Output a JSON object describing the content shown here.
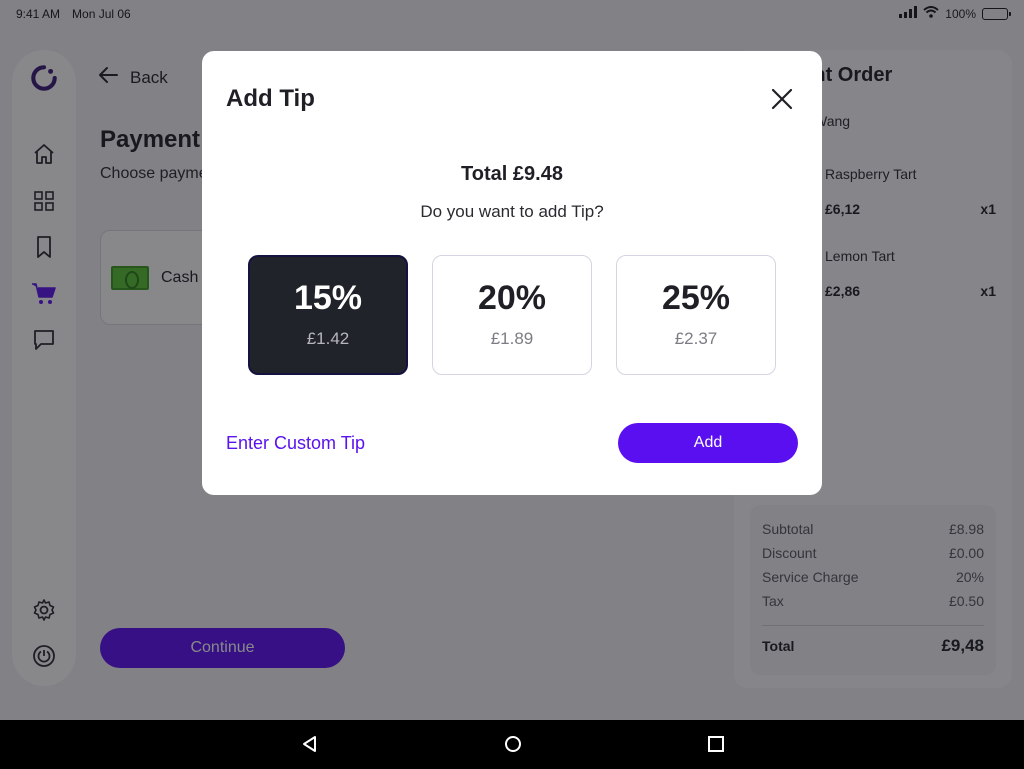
{
  "status_bar": {
    "time": "9:41 AM",
    "date": "Mon Jul 06",
    "battery": "100%"
  },
  "sidebar": {
    "items": [
      {
        "name": "home",
        "icon": "home-icon"
      },
      {
        "name": "grid",
        "icon": "grid-icon"
      },
      {
        "name": "bookmark",
        "icon": "bookmark-icon"
      },
      {
        "name": "cart",
        "icon": "cart-icon",
        "active": true
      },
      {
        "name": "chat",
        "icon": "chat-icon"
      },
      {
        "name": "settings",
        "icon": "gear-icon"
      },
      {
        "name": "power",
        "icon": "power-icon"
      }
    ],
    "active_color": "#5a12ee"
  },
  "page": {
    "back_label": "Back",
    "title": "Payment",
    "subtitle": "Choose payment",
    "payment_option": "Cash",
    "continue_label": "Continue"
  },
  "order": {
    "title": "Current Order",
    "customer": "Wang",
    "items": [
      {
        "name": "Raspberry Tart",
        "price": "£6,12",
        "qty": "x1"
      },
      {
        "name": "Lemon Tart",
        "price": "£2,86",
        "qty": "x1"
      }
    ],
    "summary": [
      {
        "label": "Subtotal",
        "value": "£8.98"
      },
      {
        "label": "Discount",
        "value": "£0.00"
      },
      {
        "label": "Service Charge",
        "value": "20%"
      },
      {
        "label": "Tax",
        "value": "£0.50"
      }
    ],
    "total_label": "Total",
    "total_value": "£9,48"
  },
  "modal": {
    "title": "Add Tip",
    "total": "Total £9.48",
    "question": "Do you want to add Tip?",
    "options": [
      {
        "percent": "15%",
        "amount": "£1.42",
        "selected": true
      },
      {
        "percent": "20%",
        "amount": "£1.89",
        "selected": false
      },
      {
        "percent": "25%",
        "amount": "£2.37",
        "selected": false
      }
    ],
    "custom_tip_label": "Enter Custom Tip",
    "add_label": "Add"
  },
  "colors": {
    "accent": "#5a0ff0",
    "selected_card": "#21232b"
  }
}
